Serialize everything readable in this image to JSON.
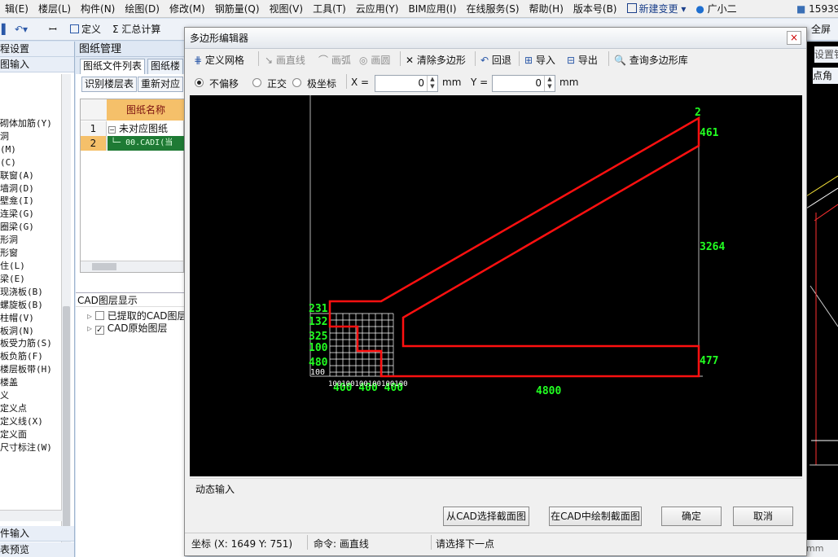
{
  "menubar": {
    "items": [
      "辑(E)",
      "楼层(L)",
      "构件(N)",
      "绘图(D)",
      "修改(M)",
      "钢筋量(Q)",
      "视图(V)",
      "工具(T)",
      "云应用(Y)",
      "BIM应用(I)",
      "在线服务(S)",
      "帮助(H)",
      "版本号(B)"
    ],
    "new_change": "新建变更",
    "user": "广小二",
    "account": "15939"
  },
  "toolbar": {
    "define": "定义",
    "summary": "汇总计算",
    "fullscreen": "全屏",
    "settings_right": "设置钅",
    "point_angle": "点角"
  },
  "left_panel": {
    "header1": "程设置",
    "header2": "图输入",
    "items": [
      "砌体加筋(Y)",
      "洞",
      "(M)",
      "(C)",
      "联窗(A)",
      "墙洞(D)",
      "壁龛(I)",
      "连梁(G)",
      "圈梁(G)",
      "形洞",
      "形窗",
      "",
      "住(L)",
      "梁(E)",
      "",
      "现浇板(B)",
      "螺旋板(B)",
      "柱帽(V)",
      "板洞(N)",
      "板受力筋(S)",
      "板负筋(F)",
      "楼层板带(H)",
      "楼盖",
      "",
      "义",
      "定义点",
      "定义线(X)",
      "定义面",
      "尺寸标注(W)"
    ],
    "footer1": "件输入",
    "footer2": "表预览"
  },
  "mid_panel": {
    "title": "图纸管理",
    "tabs": [
      "图纸文件列表",
      "图纸楼"
    ],
    "buttons": [
      "识别楼层表",
      "重新对应"
    ],
    "grid_header": "图纸名称",
    "rows": [
      {
        "num": "1",
        "text": "未对应图纸"
      },
      {
        "num": "2",
        "text": "00.CADI(当"
      }
    ],
    "layer_title": "CAD图层显示",
    "layers": [
      {
        "label": "已提取的CAD图层",
        "checked": false
      },
      {
        "label": "CAD原始图层",
        "checked": true
      }
    ]
  },
  "dialog": {
    "title": "多边形编辑器",
    "close": "×",
    "toolbar": {
      "grid": "定义网格",
      "line": "画直线",
      "arc": "画弧",
      "circle": "画圆",
      "clear": "清除多边形",
      "undo": "回退",
      "import": "导入",
      "export": "导出",
      "query": "查询多边形库"
    },
    "options": {
      "no_offset": "不偏移",
      "ortho": "正交",
      "polar": "极坐标",
      "x_label": "X =",
      "x_value": "0",
      "x_unit": "mm",
      "y_label": "Y =",
      "y_value": "0",
      "y_unit": "mm"
    },
    "canvas_dims": {
      "top_right": "2",
      "right_1": "461",
      "right_2": "3264",
      "right_3": "477",
      "bottom_main": "4800",
      "bottom_small": "400 400 400",
      "left_labels": [
        "231",
        "132",
        "325",
        "100",
        "480",
        "100"
      ],
      "bottom_grid_labels": "100100100100100100"
    },
    "dynamic_input": "动态输入",
    "buttons": {
      "from_cad": "从CAD选择截面图",
      "draw_cad": "在CAD中绘制截面图",
      "ok": "确定",
      "cancel": "取消"
    },
    "status": {
      "coords": "坐标 (X: 1649 Y: 751)",
      "command": "命令: 画直线",
      "prompt": "请选择下一点"
    }
  },
  "colors": {
    "polygon": "#ff1010",
    "dims": "#22ff22",
    "canvas": "#000000",
    "grid_header": "#f5c06a",
    "selected_row": "#1e7a34"
  }
}
